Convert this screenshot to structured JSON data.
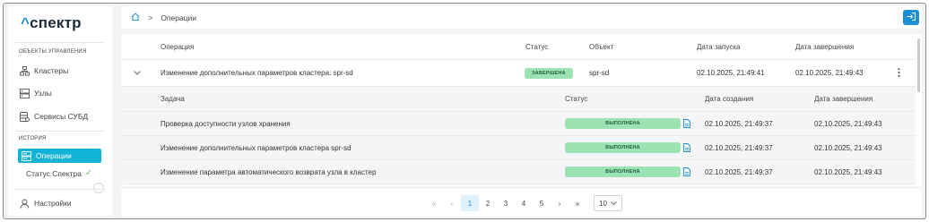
{
  "app": {
    "logo_caret": "^",
    "logo_text": "спектр"
  },
  "sidebar": {
    "section_objects": "ОБЪЕКТЫ УПРАВЛЕНИЯ",
    "section_history": "ИСТОРИЯ",
    "items": [
      {
        "label": "Кластеры",
        "icon": "cluster-icon"
      },
      {
        "label": "Узлы",
        "icon": "server-icon"
      },
      {
        "label": "Сервисы СУБД",
        "icon": "database-icon"
      },
      {
        "label": "Операции",
        "icon": "operations-icon"
      }
    ],
    "status_label": "Статус Спектра",
    "settings_label": "Настройки"
  },
  "breadcrumb": {
    "current": "Операции"
  },
  "table": {
    "headers": {
      "operation": "Операция",
      "status": "Статус",
      "object": "Объект",
      "start": "Дата запуска",
      "end": "Дата завершения"
    },
    "row": {
      "operation": "Изменение дополнительных параметров кластера: spr-sd",
      "status": "ЗАВЕРШЕНА",
      "object": "spr-sd",
      "start": "02.10.2025, 21:49:41",
      "end": "02.10.2025, 21:49:43"
    },
    "subheaders": {
      "task": "Задача",
      "status": "Статус",
      "created": "Дата создания",
      "end": "Дата завершения"
    },
    "tasks": [
      {
        "task": "Проверка доступности узлов хранения",
        "status": "ВЫПОЛНЕНА",
        "created": "02.10.2025, 21:49:37",
        "end": "02.10.2025, 21:49:43"
      },
      {
        "task": "Изменение дополнительных параметров кластера spr-sd",
        "status": "ВЫПОЛНЕНА",
        "created": "02.10.2025, 21:49:37",
        "end": "02.10.2025, 21:49:43"
      },
      {
        "task": "Изменение параметра автоматического возврата узла в кластер",
        "status": "ВЫПОЛНЕНА",
        "created": "02.10.2025, 21:49:37",
        "end": "02.10.2025, 21:49:43"
      }
    ]
  },
  "pagination": {
    "first": "«",
    "prev": "‹",
    "pages": [
      "1",
      "2",
      "3",
      "4",
      "5"
    ],
    "current": "1",
    "next": "›",
    "last": "»",
    "page_size": "10"
  },
  "colors": {
    "accent": "#1a8fd6",
    "active_nav": "#12b3d6",
    "status_badge": "#9be3b2"
  }
}
